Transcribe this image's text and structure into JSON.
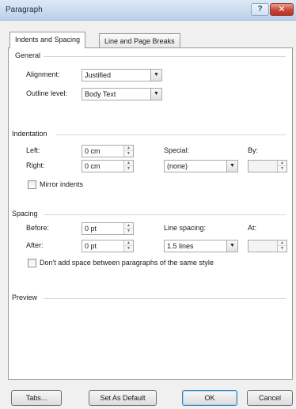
{
  "window": {
    "title": "Paragraph",
    "help_glyph": "?",
    "close_glyph": "✕"
  },
  "tabs": [
    {
      "label": "Indents and Spacing",
      "active": true
    },
    {
      "label": "Line and Page Breaks",
      "active": false
    }
  ],
  "general": {
    "heading": "General",
    "alignment_label": "Alignment:",
    "alignment_value": "Justified",
    "outline_label": "Outline level:",
    "outline_value": "Body Text"
  },
  "indentation": {
    "heading": "Indentation",
    "left_label": "Left:",
    "left_value": "0 cm",
    "right_label": "Right:",
    "right_value": "0 cm",
    "special_label": "Special:",
    "special_value": "(none)",
    "by_label": "By:",
    "by_value": "",
    "mirror_label": "Mirror indents",
    "mirror_checked": false
  },
  "spacing": {
    "heading": "Spacing",
    "before_label": "Before:",
    "before_value": "0 pt",
    "after_label": "After:",
    "after_value": "0 pt",
    "line_spacing_label": "Line spacing:",
    "line_spacing_value": "1.5 lines",
    "at_label": "At:",
    "at_value": "",
    "dont_add_label": "Don't add space between paragraphs of the same style",
    "dont_add_checked": false
  },
  "preview": {
    "heading": "Preview"
  },
  "buttons": {
    "tabs": "Tabs...",
    "set_default": "Set As Default",
    "ok": "OK",
    "cancel": "Cancel"
  },
  "colors": {
    "titlebar": "#c9daef",
    "close": "#c9473a",
    "dialog": "#f0f0f0"
  }
}
